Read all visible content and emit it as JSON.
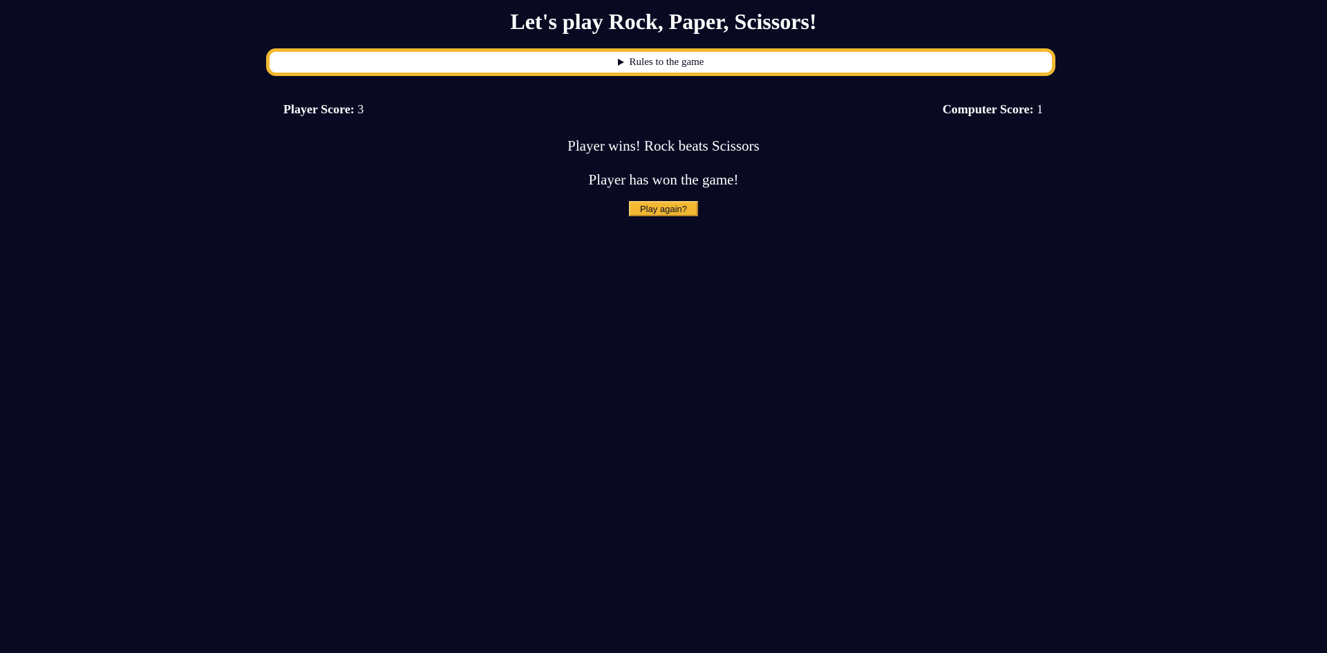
{
  "page": {
    "title": "Let's play Rock, Paper, Scissors!"
  },
  "rules": {
    "summary": "Rules to the game",
    "icon": "disclosure-triangle-icon"
  },
  "scores": {
    "player_label": "Player Score:",
    "player_value": "3",
    "computer_label": "Computer Score:",
    "computer_value": "1"
  },
  "messages": {
    "round_result": "Player wins! Rock beats Scissors",
    "game_result": "Player has won the game!"
  },
  "actions": {
    "play_again_label": "Play again?"
  },
  "colors": {
    "background": "#090a22",
    "accent": "#f2b832",
    "text": "#ffffff"
  }
}
